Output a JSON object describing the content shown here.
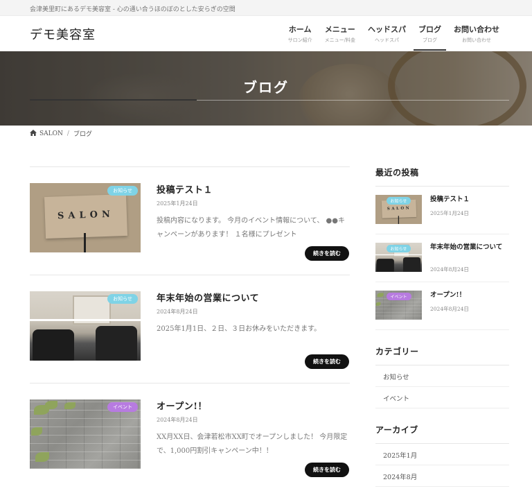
{
  "topbar": {
    "text": "会津美里町にあるデモ美容室 - 心の通い合うほのぼのとした安らぎの空間"
  },
  "header": {
    "logo": "デモ美容室",
    "nav": [
      {
        "label": "ホーム",
        "sub": "サロン紹介"
      },
      {
        "label": "メニュー",
        "sub": "メニュー/料金"
      },
      {
        "label": "ヘッドスパ",
        "sub": "ヘッドスパ"
      },
      {
        "label": "ブログ",
        "sub": "ブログ"
      },
      {
        "label": "お問い合わせ",
        "sub": "お問い合わせ"
      }
    ]
  },
  "hero": {
    "title": "ブログ"
  },
  "breadcrumb": {
    "home": "SALON",
    "separator": "/",
    "current": "ブログ"
  },
  "posts": [
    {
      "title": "投稿テスト１",
      "date": "2025年1月24日",
      "badge": "お知らせ",
      "excerpt": "投稿内容になります。 今月のイベント情報について、 ●●キャンペーンがあります！ １名様にプレゼント",
      "read_more": "続きを読む"
    },
    {
      "title": "年末年始の営業について",
      "date": "2024年8月24日",
      "badge": "お知らせ",
      "excerpt": "2025年1月1日、２日、３日お休みをいただきます。",
      "read_more": "続きを読む"
    },
    {
      "title": "オープン!！",
      "date": "2024年8月24日",
      "badge": "イベント",
      "excerpt": "XX月XX日、会津若松市XX町でオープンしました！ 今月限定で、1,000円割引キャンペーン中！！",
      "read_more": "続きを読む"
    }
  ],
  "sidebar": {
    "recent_heading": "最近の投稿",
    "recent": [
      {
        "title": "投稿テスト１",
        "date": "2025年1月24日",
        "badge": "お知らせ"
      },
      {
        "title": "年末年始の営業について",
        "date": "2024年8月24日",
        "badge": "お知らせ"
      },
      {
        "title": "オープン!！",
        "date": "2024年8月24日",
        "badge": "イベント"
      }
    ],
    "category_heading": "カテゴリー",
    "categories": [
      "お知らせ",
      "イベント"
    ],
    "archive_heading": "アーカイブ",
    "archives": [
      "2025年1月",
      "2024年8月"
    ]
  },
  "colors": {
    "badge_info": "#7fd3e6",
    "badge_event": "#b77be0",
    "button": "#111111",
    "accent_line": "#333333"
  },
  "icons": {
    "breadcrumb_home": "home-icon"
  }
}
